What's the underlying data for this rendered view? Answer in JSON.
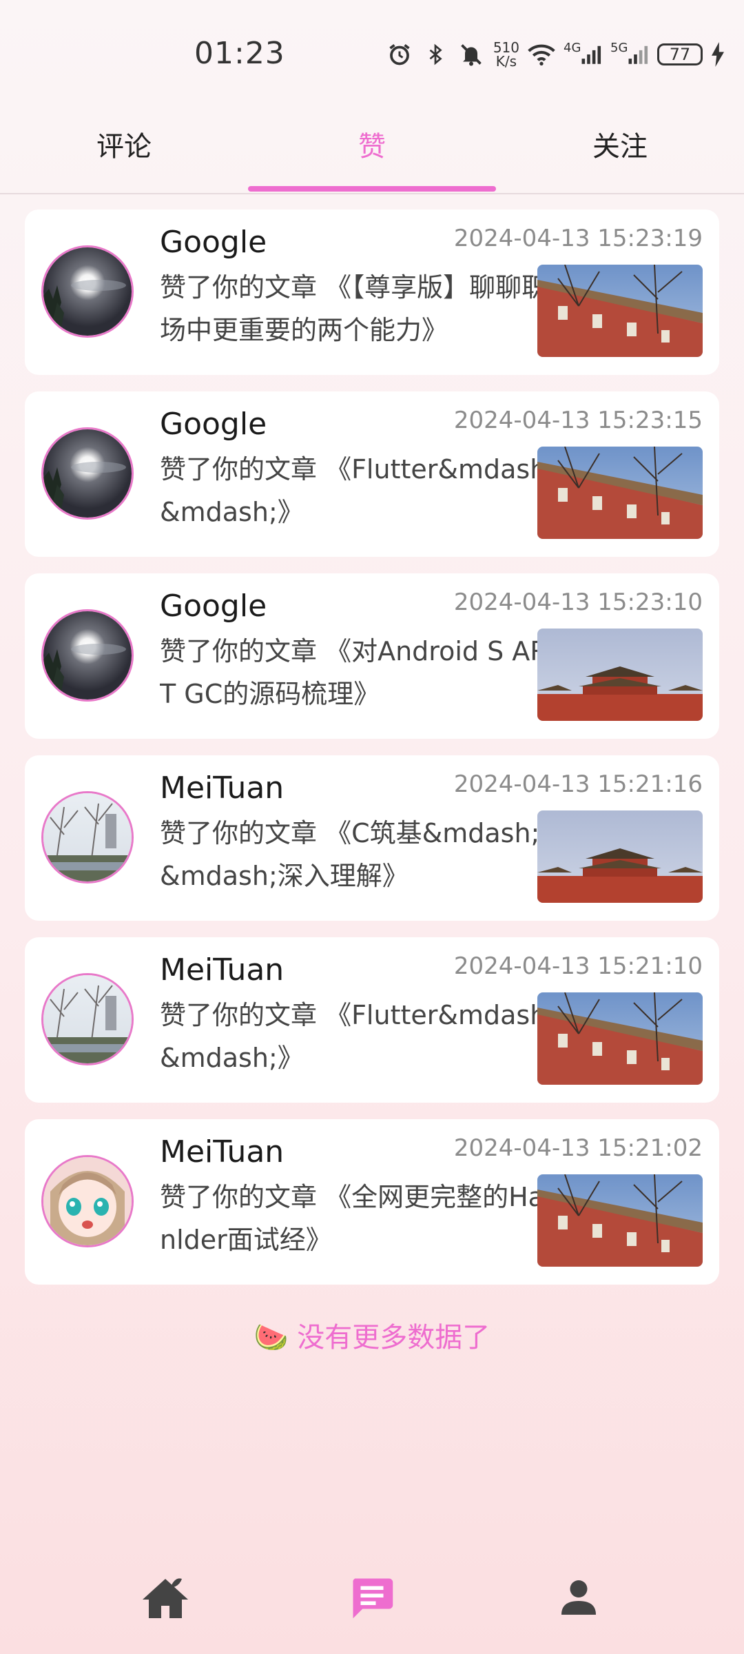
{
  "status_bar": {
    "time": "01:23",
    "net_speed_value": "510",
    "net_speed_unit": "K/s",
    "net_4g": "4G",
    "net_5g": "5G",
    "battery": "77"
  },
  "tabs": [
    {
      "label": "评论"
    },
    {
      "label": "赞",
      "active": true
    },
    {
      "label": "关注"
    }
  ],
  "notifications": [
    {
      "name": "Google",
      "date": "2024-04-13 15:23:19",
      "text": "赞了你的文章 《【尊享版】聊聊职场中更重要的两个能力》",
      "avatar": "moon",
      "thumb": "wall"
    },
    {
      "name": "Google",
      "date": "2024-04-13 15:23:15",
      "text": "赞了你的文章 《Flutter&mdash;&mdash;》",
      "avatar": "moon",
      "thumb": "wall"
    },
    {
      "name": "Google",
      "date": "2024-04-13 15:23:10",
      "text": "赞了你的文章 《对Android S ART GC的源码梳理》",
      "avatar": "moon",
      "thumb": "palace"
    },
    {
      "name": "MeiTuan",
      "date": "2024-04-13 15:21:16",
      "text": "赞了你的文章 《C筑基&mdash;&mdash;深入理解》",
      "avatar": "trees",
      "thumb": "palace"
    },
    {
      "name": "MeiTuan",
      "date": "2024-04-13 15:21:10",
      "text": "赞了你的文章 《Flutter&mdash;&mdash;》",
      "avatar": "trees",
      "thumb": "wall"
    },
    {
      "name": "MeiTuan",
      "date": "2024-04-13 15:21:02",
      "text": "赞了你的文章 《全网更完整的Hanlder面试经》",
      "avatar": "anime",
      "thumb": "wall"
    }
  ],
  "footer": {
    "no_more": "🍉 没有更多数据了"
  },
  "bottom_nav": [
    {
      "icon": "home-icon"
    },
    {
      "icon": "message-icon",
      "active": true
    },
    {
      "icon": "person-icon"
    }
  ],
  "colors": {
    "accent": "#ee6dcf",
    "nav_icon": "#444444"
  }
}
